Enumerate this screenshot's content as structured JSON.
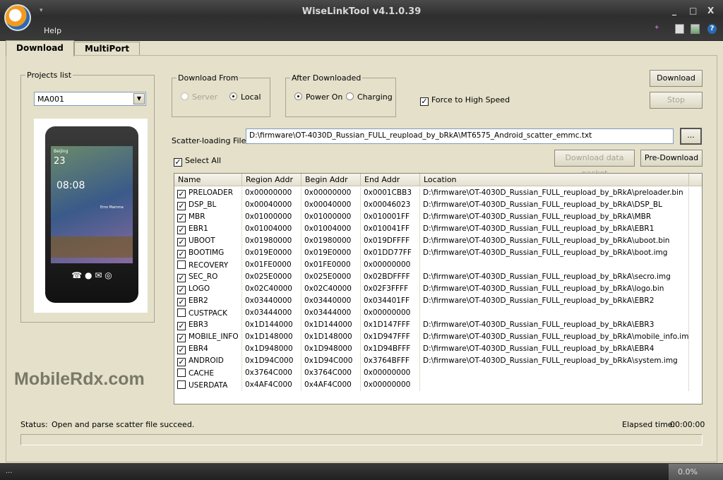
{
  "window": {
    "title": "WiseLinkTool v4.1.0.39",
    "menu_help": "Help",
    "minimize": "_",
    "maximize": "□",
    "close": "X"
  },
  "tabs": [
    {
      "label": "Download",
      "active": true
    },
    {
      "label": "MultiPort",
      "active": false
    }
  ],
  "projects": {
    "legend": "Projects list",
    "selected": "MA001"
  },
  "download_from": {
    "legend": "Download From",
    "options": [
      {
        "label": "Server",
        "checked": false,
        "disabled": true
      },
      {
        "label": "Local",
        "checked": true,
        "disabled": false
      }
    ]
  },
  "after_downloaded": {
    "legend": "After Downloaded",
    "options": [
      {
        "label": "Power On",
        "checked": true
      },
      {
        "label": "Charging",
        "checked": false
      }
    ]
  },
  "force_high_speed": {
    "label": "Force to High Speed",
    "checked": true
  },
  "buttons": {
    "download": "Download",
    "stop": "Stop",
    "browse": "...",
    "download_data_packet": "Download data packet",
    "pre_download": "Pre-Download"
  },
  "scatter": {
    "label": "Scatter-loading File:",
    "value": "D:\\firmware\\OT-4030D_Russian_FULL_reupload_by_bRkA\\MT6575_Android_scatter_emmc.txt"
  },
  "select_all": {
    "label": "Select All",
    "checked": true
  },
  "table": {
    "columns": [
      "Name",
      "Region Addr",
      "Begin Addr",
      "End Addr",
      "Location"
    ],
    "rows": [
      {
        "checked": true,
        "name": "PRELOADER",
        "region": "0x00000000",
        "begin": "0x00000000",
        "end": "0x0001CBB3",
        "location": "D:\\firmware\\OT-4030D_Russian_FULL_reupload_by_bRkA\\preloader.bin"
      },
      {
        "checked": true,
        "name": "DSP_BL",
        "region": "0x00040000",
        "begin": "0x00040000",
        "end": "0x00046023",
        "location": "D:\\firmware\\OT-4030D_Russian_FULL_reupload_by_bRkA\\DSP_BL"
      },
      {
        "checked": true,
        "name": "MBR",
        "region": "0x01000000",
        "begin": "0x01000000",
        "end": "0x010001FF",
        "location": "D:\\firmware\\OT-4030D_Russian_FULL_reupload_by_bRkA\\MBR"
      },
      {
        "checked": true,
        "name": "EBR1",
        "region": "0x01004000",
        "begin": "0x01004000",
        "end": "0x010041FF",
        "location": "D:\\firmware\\OT-4030D_Russian_FULL_reupload_by_bRkA\\EBR1"
      },
      {
        "checked": true,
        "name": "UBOOT",
        "region": "0x01980000",
        "begin": "0x01980000",
        "end": "0x019DFFFF",
        "location": "D:\\firmware\\OT-4030D_Russian_FULL_reupload_by_bRkA\\uboot.bin"
      },
      {
        "checked": true,
        "name": "BOOTIMG",
        "region": "0x019E0000",
        "begin": "0x019E0000",
        "end": "0x01DD77FF",
        "location": "D:\\firmware\\OT-4030D_Russian_FULL_reupload_by_bRkA\\boot.img"
      },
      {
        "checked": false,
        "name": "RECOVERY",
        "region": "0x01FE0000",
        "begin": "0x01FE0000",
        "end": "0x00000000",
        "location": ""
      },
      {
        "checked": true,
        "name": "SEC_RO",
        "region": "0x025E0000",
        "begin": "0x025E0000",
        "end": "0x02BDFFFF",
        "location": "D:\\firmware\\OT-4030D_Russian_FULL_reupload_by_bRkA\\secro.img"
      },
      {
        "checked": true,
        "name": "LOGO",
        "region": "0x02C40000",
        "begin": "0x02C40000",
        "end": "0x02F3FFFF",
        "location": "D:\\firmware\\OT-4030D_Russian_FULL_reupload_by_bRkA\\logo.bin"
      },
      {
        "checked": true,
        "name": "EBR2",
        "region": "0x03440000",
        "begin": "0x03440000",
        "end": "0x034401FF",
        "location": "D:\\firmware\\OT-4030D_Russian_FULL_reupload_by_bRkA\\EBR2"
      },
      {
        "checked": false,
        "name": "CUSTPACK",
        "region": "0x03444000",
        "begin": "0x03444000",
        "end": "0x00000000",
        "location": ""
      },
      {
        "checked": true,
        "name": "EBR3",
        "region": "0x1D144000",
        "begin": "0x1D144000",
        "end": "0x1D147FFF",
        "location": "D:\\firmware\\OT-4030D_Russian_FULL_reupload_by_bRkA\\EBR3"
      },
      {
        "checked": true,
        "name": "MOBILE_INFO",
        "region": "0x1D148000",
        "begin": "0x1D148000",
        "end": "0x1D947FFF",
        "location": "D:\\firmware\\OT-4030D_Russian_FULL_reupload_by_bRkA\\mobile_info.img"
      },
      {
        "checked": true,
        "name": "EBR4",
        "region": "0x1D948000",
        "begin": "0x1D948000",
        "end": "0x1D94BFFF",
        "location": "D:\\firmware\\OT-4030D_Russian_FULL_reupload_by_bRkA\\EBR4"
      },
      {
        "checked": true,
        "name": "ANDROID",
        "region": "0x1D94C000",
        "begin": "0x1D94C000",
        "end": "0x3764BFFF",
        "location": "D:\\firmware\\OT-4030D_Russian_FULL_reupload_by_bRkA\\system.img"
      },
      {
        "checked": false,
        "name": "CACHE",
        "region": "0x3764C000",
        "begin": "0x3764C000",
        "end": "0x00000000",
        "location": ""
      },
      {
        "checked": false,
        "name": "USERDATA",
        "region": "0x4AF4C000",
        "begin": "0x4AF4C000",
        "end": "0x00000000",
        "location": ""
      }
    ]
  },
  "status": {
    "label": "Status:",
    "text": "Open and parse scatter file succeed.",
    "elapsed_label": "Elapsed time:",
    "elapsed": "00:00:00",
    "progress_percent": 0
  },
  "bottom": {
    "dots": "...",
    "percent": "0.0%"
  },
  "phone": {
    "time": "08:08",
    "temp": "23",
    "city": "Beijing",
    "song": "Emo Mamma"
  },
  "watermark": "MobileRdx.com",
  "colors": {
    "titlebar": "#333333",
    "body": "#e4e0ca",
    "accent": "#2a6bb5"
  }
}
